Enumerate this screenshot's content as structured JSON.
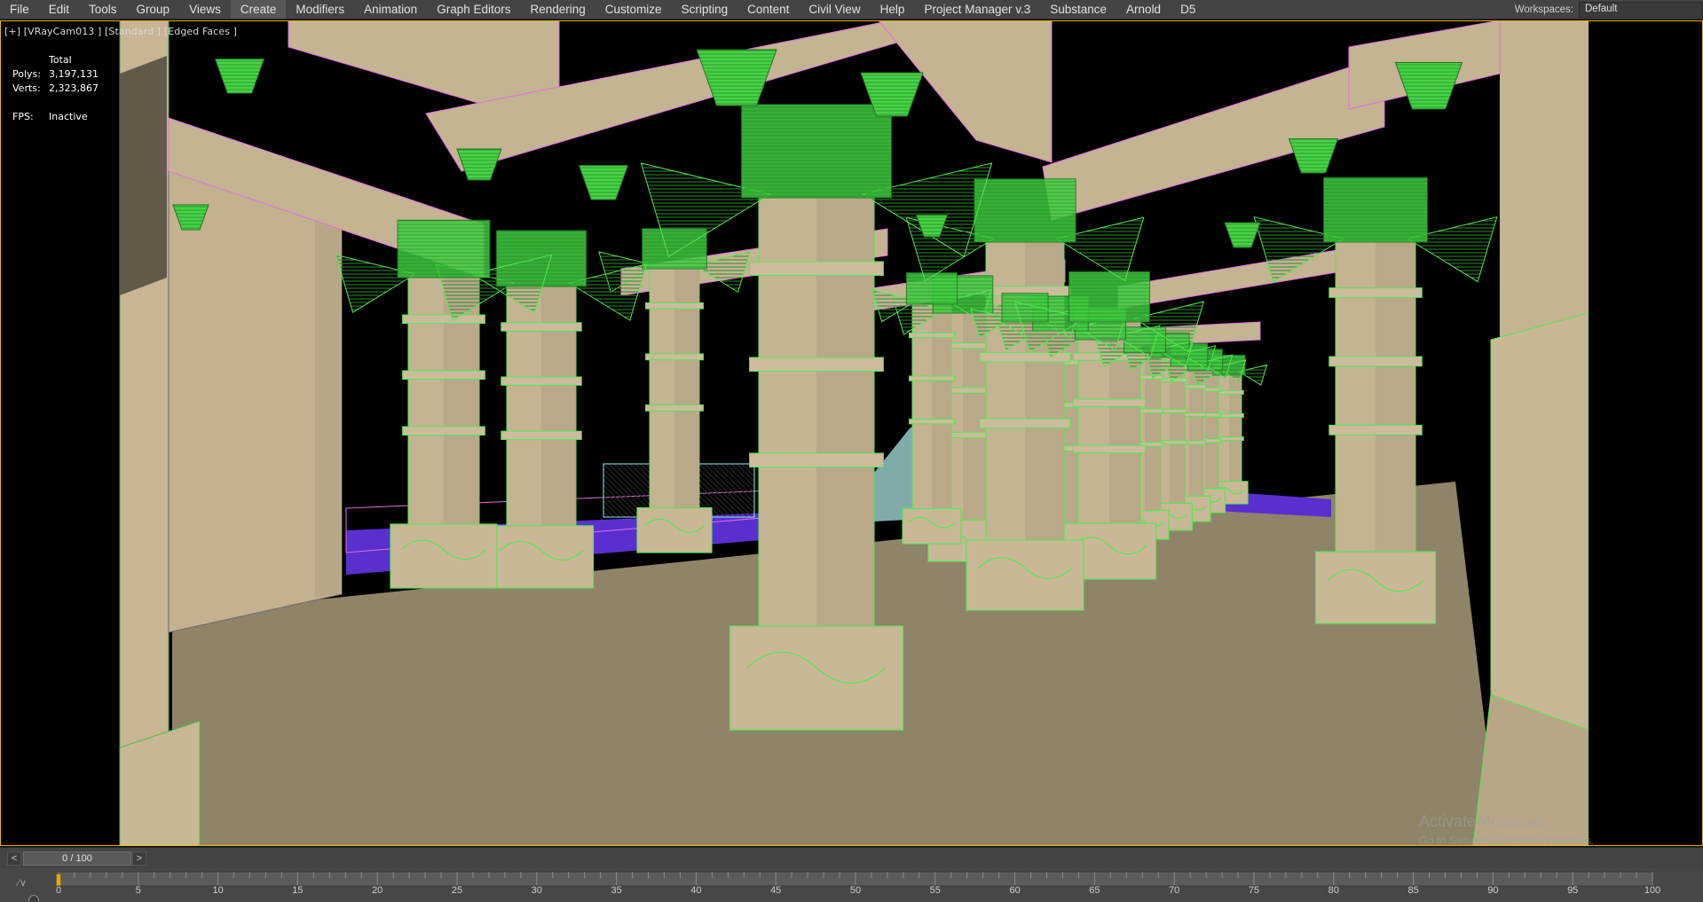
{
  "menu": {
    "items": [
      {
        "id": "file",
        "label": "File"
      },
      {
        "id": "edit",
        "label": "Edit"
      },
      {
        "id": "tools",
        "label": "Tools"
      },
      {
        "id": "group",
        "label": "Group"
      },
      {
        "id": "views",
        "label": "Views"
      },
      {
        "id": "create",
        "label": "Create"
      },
      {
        "id": "modifiers",
        "label": "Modifiers"
      },
      {
        "id": "animation",
        "label": "Animation"
      },
      {
        "id": "graph-editors",
        "label": "Graph Editors"
      },
      {
        "id": "rendering",
        "label": "Rendering"
      },
      {
        "id": "customize",
        "label": "Customize"
      },
      {
        "id": "scripting",
        "label": "Scripting"
      },
      {
        "id": "content",
        "label": "Content"
      },
      {
        "id": "civil-view",
        "label": "Civil View"
      },
      {
        "id": "help",
        "label": "Help"
      },
      {
        "id": "project-manager",
        "label": "Project Manager v.3"
      },
      {
        "id": "substance",
        "label": "Substance"
      },
      {
        "id": "arnold",
        "label": "Arnold"
      },
      {
        "id": "d5",
        "label": "D5"
      }
    ],
    "active": "create"
  },
  "workspace": {
    "label": "Workspaces:",
    "value": "Default"
  },
  "viewport": {
    "label": "[+] [VRayCam013 ] [Standard ] [Edged Faces ]",
    "stats": {
      "header": "Total",
      "polys_label": "Polys:",
      "polys_value": "3,197,131",
      "verts_label": "Verts:",
      "verts_value": "2,323,867",
      "fps_label": "FPS:",
      "fps_value": "Inactive"
    },
    "watermark": "Activate Windows",
    "watermark_sub": "Go to Settings to activate Windows."
  },
  "timeslider": {
    "frame_text": "0 / 100",
    "prev_icon": "chevron-left-icon",
    "next_icon": "chevron-right-icon"
  },
  "trackbar": {
    "tick_labels": [
      "0",
      "5",
      "10",
      "15",
      "20",
      "25",
      "30",
      "35",
      "40",
      "45",
      "50",
      "55",
      "60",
      "65",
      "70",
      "75",
      "80",
      "85",
      "90",
      "95",
      "100"
    ],
    "icon": "filter-icon"
  },
  "colors": {
    "menubar_bg": "#444444",
    "viewport_border": "#e8b800",
    "edge_green": "#55e655",
    "stone": "#c4b492",
    "floor": "#8f8468",
    "rail_purple": "#5a2fcf",
    "cyan": "#8ff0f0",
    "magenta": "#e06fe0"
  }
}
